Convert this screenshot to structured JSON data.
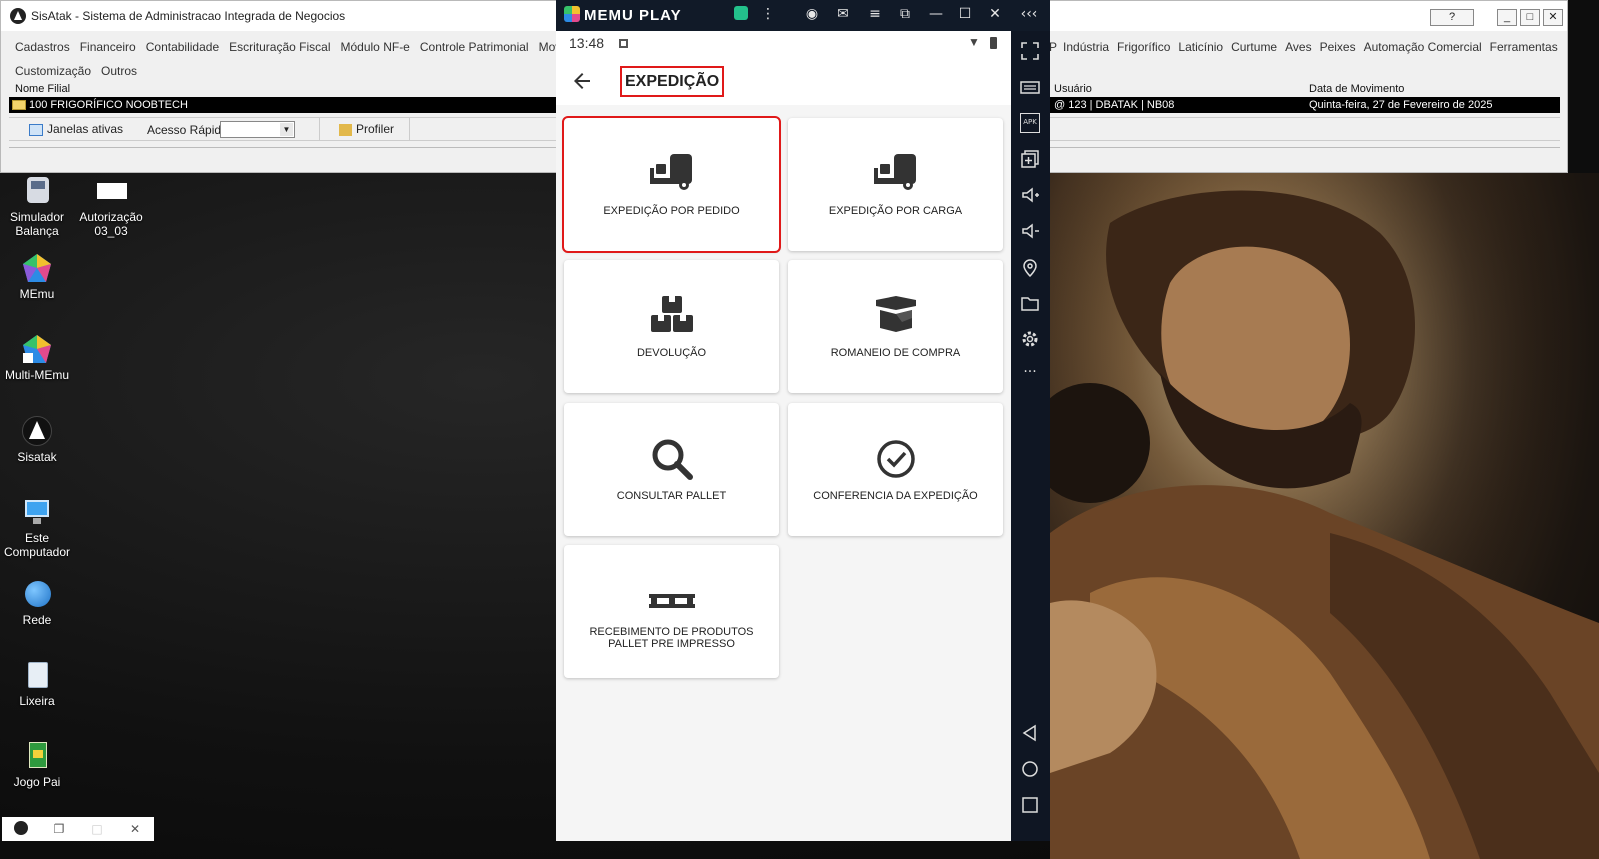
{
  "sisatak": {
    "title": "SisAtak - Sistema de Administracao Integrada de Negocios",
    "help_label": "?",
    "menu_row1": [
      "Cadastros",
      "Financeiro",
      "Contabilidade",
      "Escrituração Fiscal",
      "Módulo NF-e",
      "Controle Patrimonial",
      "Movim"
    ],
    "menu_row1_right": [
      "P",
      "Indústria",
      "Frigorífico",
      "Laticínio",
      "Curtume",
      "Aves",
      "Peixes",
      "Automação Comercial",
      "Ferramentas"
    ],
    "menu_row2": [
      "Customização",
      "Outros"
    ],
    "grid_headers": {
      "filial": "Nome Filial",
      "usuario": "Usuário",
      "data": "Data de Movimento"
    },
    "grid_row": {
      "filial": "100 FRIGORÍFICO NOOBTECH",
      "usuario": "@ 123 | DBATAK | NB08",
      "data": "Quinta-feira, 27 de Fevereiro de 2025"
    },
    "toolbar": {
      "janelas": "Janelas ativas",
      "acesso_rapido": "Acesso Rápido",
      "profiler": "Profiler"
    }
  },
  "desktop_icons": [
    {
      "label": "Simulador Balança"
    },
    {
      "label": "Autorização 03_03"
    },
    {
      "label": "MEmu"
    },
    {
      "label": "Multi-MEmu"
    },
    {
      "label": "Sisatak"
    },
    {
      "label": "Este Computador"
    },
    {
      "label": "Rede"
    },
    {
      "label": "Lixeira"
    },
    {
      "label": "Jogo Pai"
    }
  ],
  "memu": {
    "logo": "MEMU PLAY",
    "status_time": "13:48",
    "page_title": "EXPEDIÇÃO",
    "tiles": [
      {
        "label": "EXPEDIÇÃO POR PEDIDO",
        "icon": "forklift-icon",
        "selected": true
      },
      {
        "label": "EXPEDIÇÃO POR CARGA",
        "icon": "forklift-icon",
        "selected": false
      },
      {
        "label": "DEVOLUÇÃO",
        "icon": "boxes-icon",
        "selected": false
      },
      {
        "label": "ROMANEIO DE COMPRA",
        "icon": "open-box-icon",
        "selected": false
      },
      {
        "label": "CONSULTAR PALLET",
        "icon": "search-icon",
        "selected": false
      },
      {
        "label": "CONFERENCIA DA EXPEDIÇÃO",
        "icon": "check-circle-icon",
        "selected": false
      },
      {
        "label": "RECEBIMENTO DE PRODUTOS PALLET PRE IMPRESSO",
        "icon": "pallet-icon",
        "selected": false
      }
    ],
    "side_apk": "APK"
  },
  "colors": {
    "highlight": "#e01919",
    "memu_frame": "#0f1623",
    "icon": "#333333"
  }
}
